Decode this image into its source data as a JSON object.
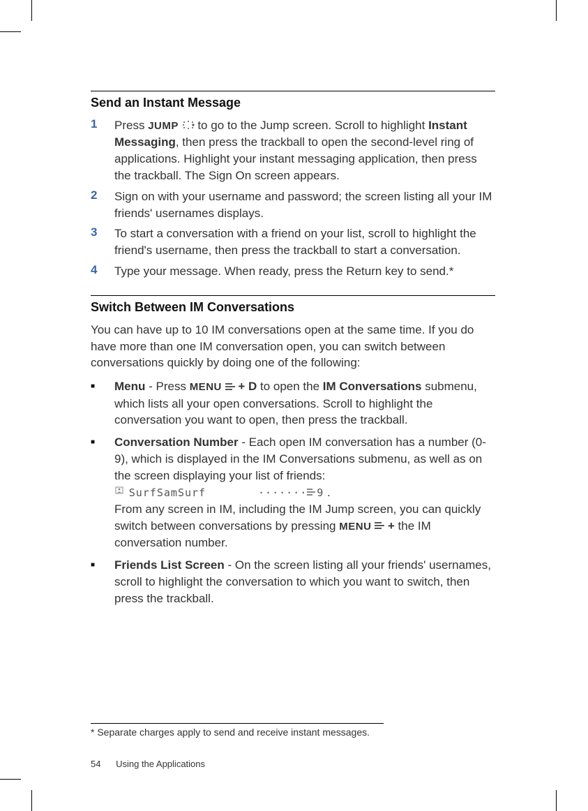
{
  "section1": {
    "title": "Send an Instant Message",
    "step1": {
      "num": "1",
      "pre": "Press ",
      "jump": "JUMP",
      "mid": " to go to the Jump screen. Scroll to highlight ",
      "im": "Instant Messaging",
      "rest": ", then press the trackball to open the second-level ring of applications. Highlight your instant messaging application, then press the trackball. The Sign On screen appears."
    },
    "step2": {
      "num": "2",
      "text": "Sign on with your username and password; the screen listing all your IM friends' usernames displays."
    },
    "step3": {
      "num": "3",
      "text": "To start a conversation with a friend on your list, scroll to highlight the friend's username, then press the trackball to start a conversation."
    },
    "step4": {
      "num": "4",
      "text": "Type your message. When ready, press the Return key to send.*"
    }
  },
  "section2": {
    "title": "Switch Between IM Conversations",
    "intro": "You can have up to 10 IM conversations open at the same time. If you do have more than one IM conversation open, you can switch between conversations quickly by doing one of the following:",
    "item1": {
      "label": "Menu",
      "pre": " - Press ",
      "menu": "MENU",
      "plusd": " + D",
      "mid": " to open the ",
      "sub": "IM Conversations",
      "rest": " submenu, which lists all your open conversations. Scroll to highlight the conversation you want to open, then press the trackball."
    },
    "item2": {
      "label": "Conversation Number",
      "line1": " - Each open IM conversation has a number (0-9), which is displayed in the IM Conversations submenu, as well as on the screen displaying your list of friends:",
      "sample": "SurfSamSurf",
      "sample_num": "9",
      "line2a": "From any screen in IM, including the IM Jump screen, you can quickly switch between conversations by pressing ",
      "menu": "MENU",
      "plus": " + ",
      "line2b": "the IM conversation number."
    },
    "item3": {
      "label": "Friends List Screen",
      "text": " - On the screen listing all your friends' usernames, scroll to highlight the conversation to which you want to switch, then press the trackball."
    }
  },
  "footnote": "* Separate charges apply to send and receive instant messages.",
  "footer": {
    "page": "54",
    "chapter": "Using the Applications"
  }
}
